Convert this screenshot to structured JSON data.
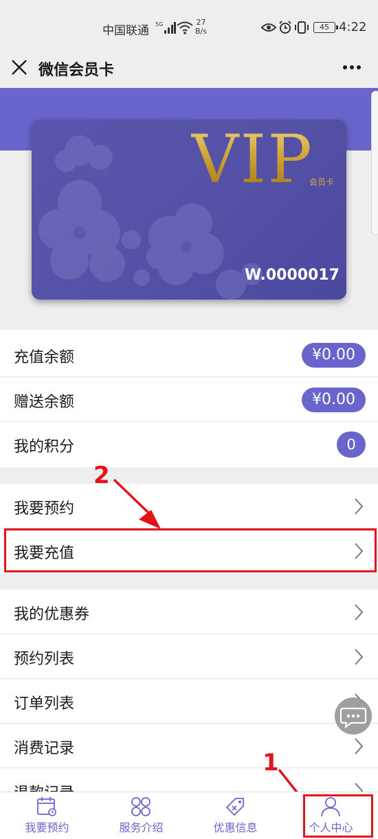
{
  "status_bar": {
    "carrier": "中国联通",
    "net_speed_value": "27",
    "net_speed_unit": "B/s",
    "battery": "45",
    "time": "4:22"
  },
  "nav": {
    "title": "微信会员卡",
    "close_icon": "close-icon",
    "more_icon": "more-icon"
  },
  "card": {
    "vip_text": "VIP",
    "vip_subtitle": "会员卡",
    "card_number": "W.0000017",
    "accent_color": "#6a65cc",
    "gold_color": "#d3a63d"
  },
  "balances": [
    {
      "label": "充值余额",
      "value": "¥0.00"
    },
    {
      "label": "赠送余额",
      "value": "¥0.00"
    },
    {
      "label": "我的积分",
      "value": "0"
    }
  ],
  "menu_group_1": [
    {
      "label": "我要预约"
    },
    {
      "label": "我要充值"
    }
  ],
  "menu_group_2": [
    {
      "label": "我的优惠券"
    },
    {
      "label": "预约列表"
    },
    {
      "label": "订单列表"
    },
    {
      "label": "消费记录"
    },
    {
      "label": "退款记录"
    }
  ],
  "annotations": {
    "step1": "1",
    "step2": "2",
    "color": "#e3121b"
  },
  "tabs": [
    {
      "label": "我要预约",
      "icon": "calendar-icon"
    },
    {
      "label": "服务介绍",
      "icon": "grid-icon"
    },
    {
      "label": "优惠信息",
      "icon": "tag-icon"
    },
    {
      "label": "个人中心",
      "icon": "person-icon"
    }
  ]
}
